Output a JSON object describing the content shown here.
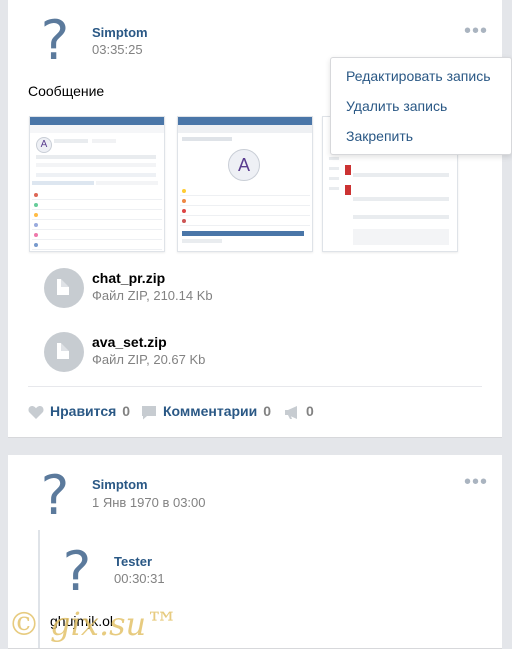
{
  "post1": {
    "author": "Simptom",
    "time": "03:35:25",
    "message": "Сообщение",
    "menu": {
      "items": [
        "Редактировать запись",
        "Удалить запись",
        "Закрепить"
      ]
    },
    "files": [
      {
        "name": "chat_pr.zip",
        "meta": "Файл ZIP, 210.14 Kb"
      },
      {
        "name": "ava_set.zip",
        "meta": "Файл ZIP, 20.67 Kb"
      }
    ],
    "actions": {
      "like_label": "Нравится",
      "like_count": "0",
      "comments_label": "Комментарии",
      "comments_count": "0",
      "share_count": "0"
    }
  },
  "post2": {
    "author": "Simptom",
    "time": "1 Янв 1970 в 03:00",
    "quoted": {
      "author": "Tester",
      "time": "00:30:31",
      "message": "ghujmjk.ol"
    }
  },
  "watermark": "© gix.su™"
}
